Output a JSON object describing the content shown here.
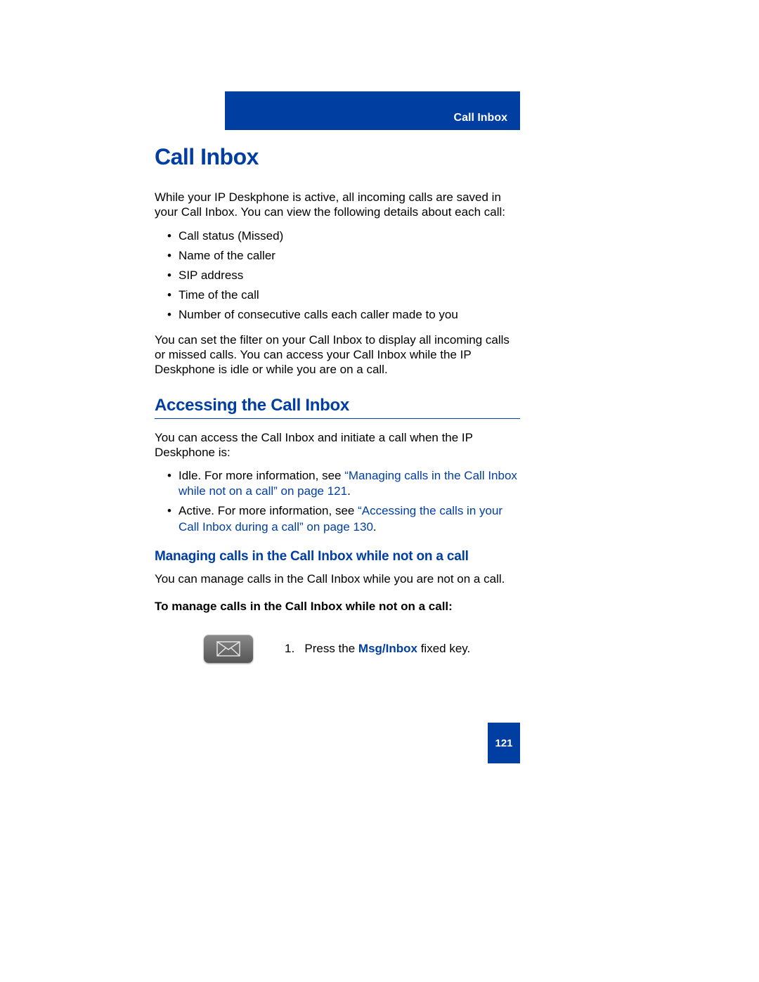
{
  "header": {
    "section_name": "Call Inbox"
  },
  "title": "Call Inbox",
  "intro": "While your IP Deskphone is active, all incoming calls are saved in your Call Inbox. You can view the following details about each call:",
  "detail_list": [
    "Call status (Missed)",
    "Name of the caller",
    "SIP address",
    "Time of the call",
    "Number of consecutive calls each caller made to you"
  ],
  "filter_note": "You can set the filter on your Call Inbox to display all incoming calls or missed calls. You can access your Call Inbox while the IP Deskphone is idle or while you are on a call.",
  "section_heading": "Accessing the Call Inbox",
  "access_intro": "You can access the Call Inbox and initiate a call when the IP Deskphone is:",
  "access_list": {
    "idle_prefix": "Idle. For more information, see ",
    "idle_link": "“Managing calls in the Call Inbox while not on a call” on page 121",
    "idle_suffix": ".",
    "active_prefix": "Active. For more information, see ",
    "active_link": "“Accessing the calls in your Call Inbox during a call” on page 130",
    "active_suffix": "."
  },
  "subsection_heading": "Managing calls in the Call Inbox while not on a call",
  "subsection_intro": "You can manage calls in the Call Inbox while you are not on a call.",
  "procedure_label": "To manage calls in the Call Inbox while not on a call:",
  "step1": {
    "number": "1.",
    "prefix": "Press the ",
    "key_label": "Msg/Inbox",
    "suffix": " fixed key."
  },
  "page_number": "121"
}
